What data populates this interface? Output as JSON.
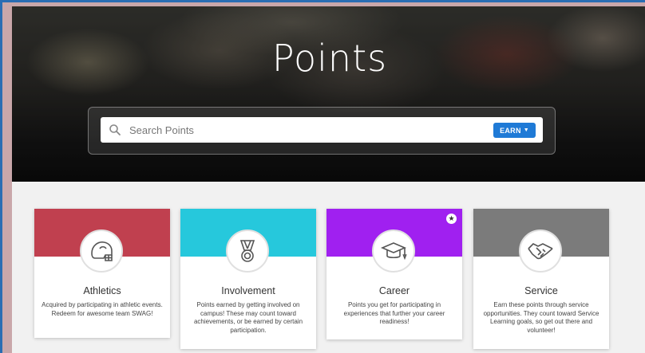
{
  "hero": {
    "title": "Points"
  },
  "search": {
    "placeholder": "Search Points",
    "earn_label": "EARN"
  },
  "cards": [
    {
      "title": "Athletics",
      "description": "Acquired by participating in athletic events. Redeem for awesome team SWAG!",
      "color": "#c0404f",
      "icon": "helmet-icon"
    },
    {
      "title": "Involvement",
      "description": "Points earned by getting involved on campus! These may count toward achievements, or be earned by certain participation.",
      "color": "#26c8dc",
      "icon": "medal-icon"
    },
    {
      "title": "Career",
      "description": "Points you get for participating in experiences that further your career readiness!",
      "color": "#a020f0",
      "icon": "graduation-cap-icon",
      "featured_icon": "star-icon"
    },
    {
      "title": "Service",
      "description": "Earn these points through service opportunities. They count toward Service Learning goals, so get out there and volunteer!",
      "color": "#7b7b7b",
      "icon": "handshake-icon"
    }
  ]
}
